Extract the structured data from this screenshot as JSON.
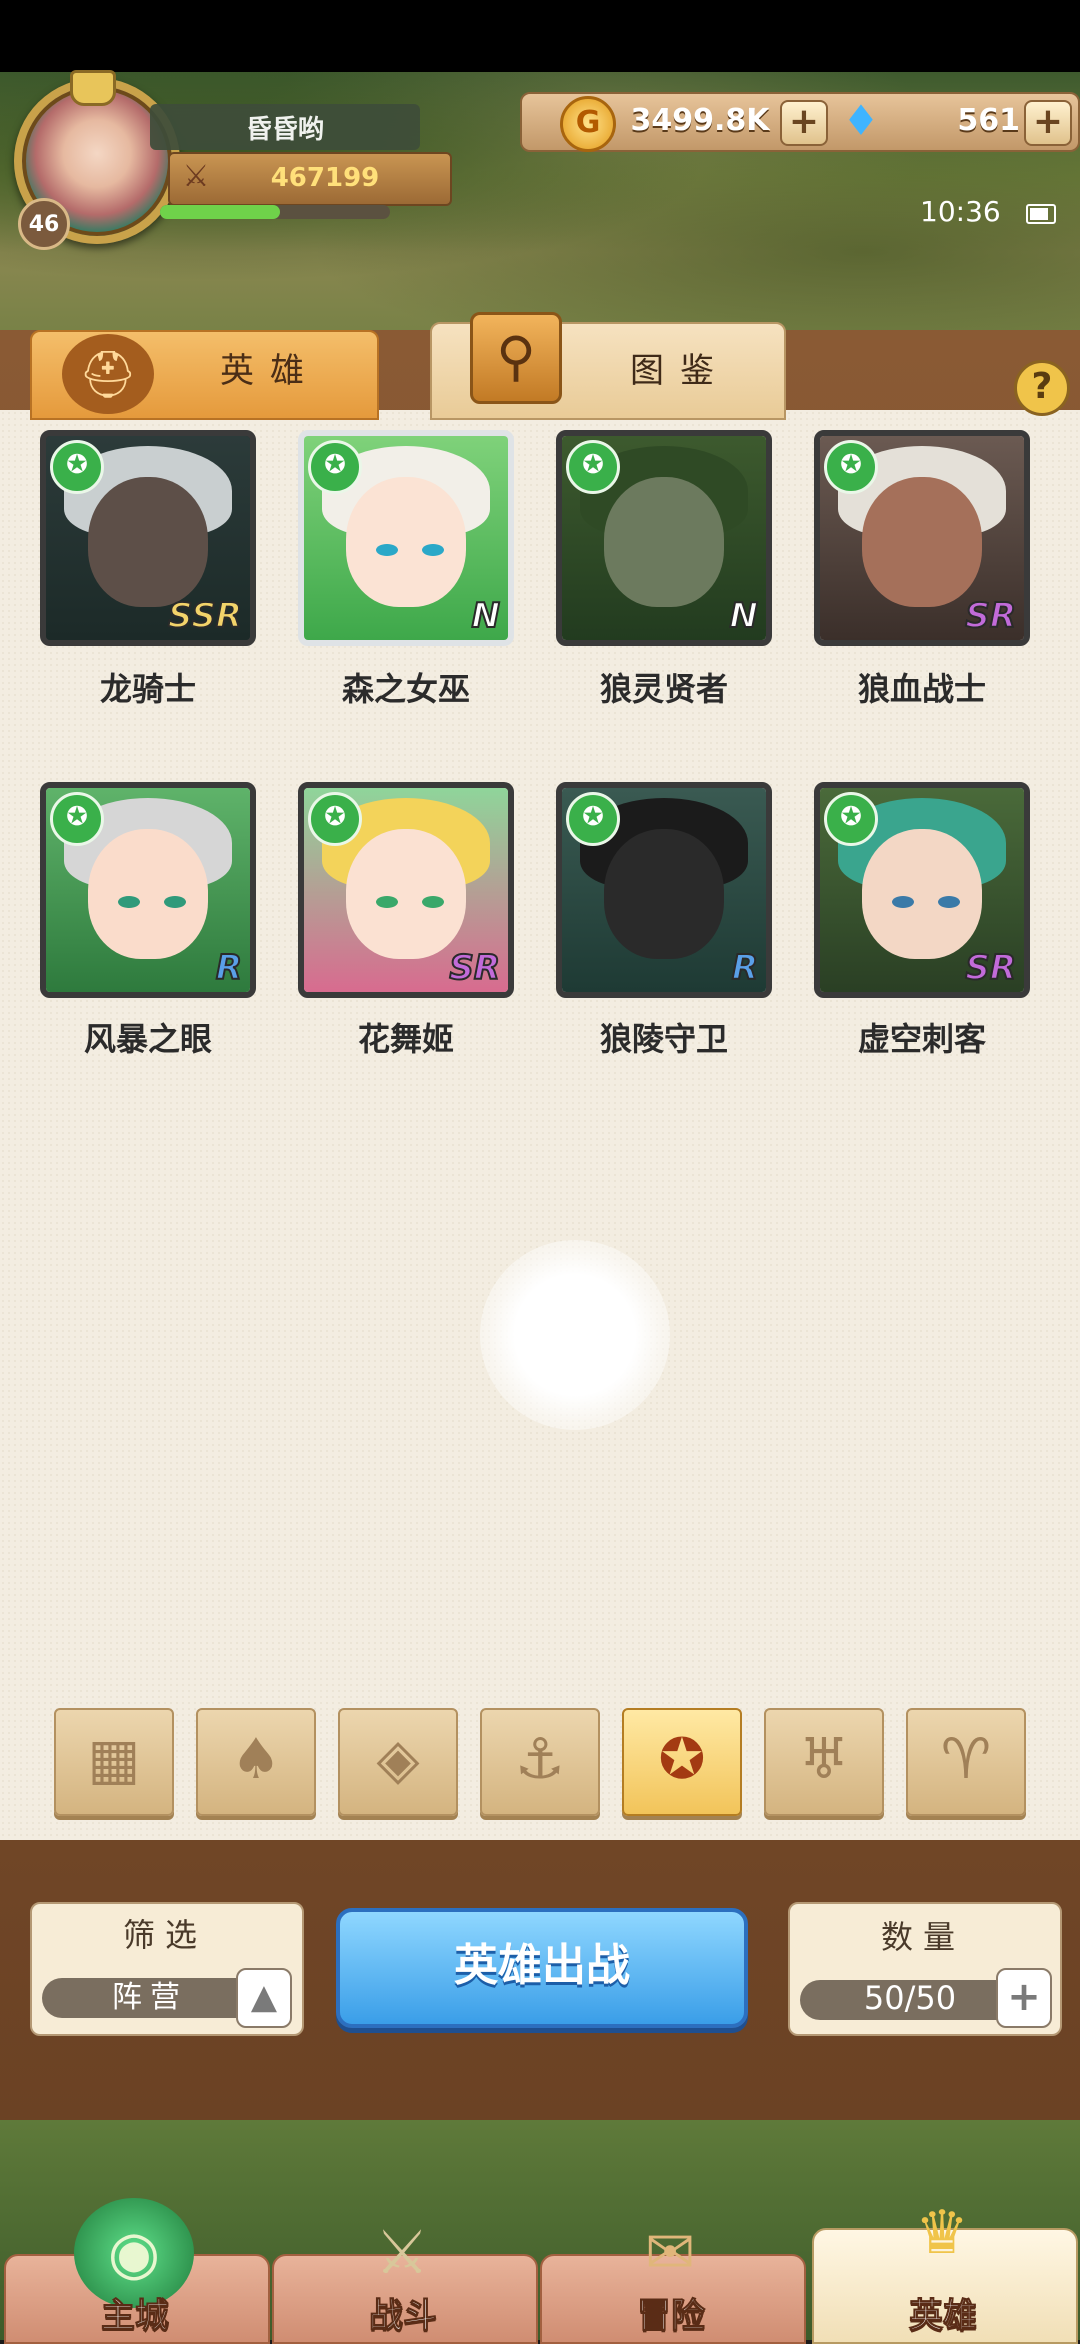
{
  "player": {
    "name": "昏昏哟",
    "level": "46",
    "power": "467199",
    "exp_progress": 0.52
  },
  "currency": {
    "gold": "3499.8K",
    "gems": "561",
    "add_symbol": "+"
  },
  "status": {
    "time": "10:36"
  },
  "tabs": [
    {
      "label": "英雄",
      "active": false
    },
    {
      "label": "图鉴",
      "active": true
    }
  ],
  "help_label": "?",
  "heroes": [
    {
      "name": "龙骑士",
      "rarity": "SSR"
    },
    {
      "name": "森之女巫",
      "rarity": "N"
    },
    {
      "name": "狼灵贤者",
      "rarity": "N"
    },
    {
      "name": "狼血战士",
      "rarity": "SR"
    },
    {
      "name": "风暴之眼",
      "rarity": "R"
    },
    {
      "name": "花舞姬",
      "rarity": "SR"
    },
    {
      "name": "狼陵守卫",
      "rarity": "R"
    },
    {
      "name": "虚空刺客",
      "rarity": "SR"
    }
  ],
  "filters": [
    {
      "icon": "grid-icon",
      "glyph": "▦",
      "active": false
    },
    {
      "icon": "leaf-icon",
      "glyph": "♠",
      "active": false
    },
    {
      "icon": "diamond-icon",
      "glyph": "◈",
      "active": false
    },
    {
      "icon": "anchor-icon",
      "glyph": "⚓",
      "active": false
    },
    {
      "icon": "wolf-icon",
      "glyph": "✪",
      "active": true
    },
    {
      "icon": "demon-icon",
      "glyph": "♅",
      "active": false
    },
    {
      "icon": "horns-icon",
      "glyph": "♈",
      "active": false
    }
  ],
  "filter_panel": {
    "title": "筛选",
    "value": "阵营",
    "toggle": "▲"
  },
  "deploy_button": "英雄出战",
  "count_panel": {
    "title": "数量",
    "value": "50/50",
    "add": "+"
  },
  "nav": [
    {
      "label": "主城",
      "active": false
    },
    {
      "label": "战斗",
      "active": false
    },
    {
      "label": "冒险",
      "active": false
    },
    {
      "label": "英雄",
      "active": true
    }
  ],
  "colors": {
    "accent": "#3a9ee8",
    "faction_green": "#3ab04a",
    "rarity_ssr": "#f3d36a",
    "rarity_sr": "#c26bd9",
    "rarity_r": "#5aa0e8",
    "rarity_n": "#ffffff"
  }
}
